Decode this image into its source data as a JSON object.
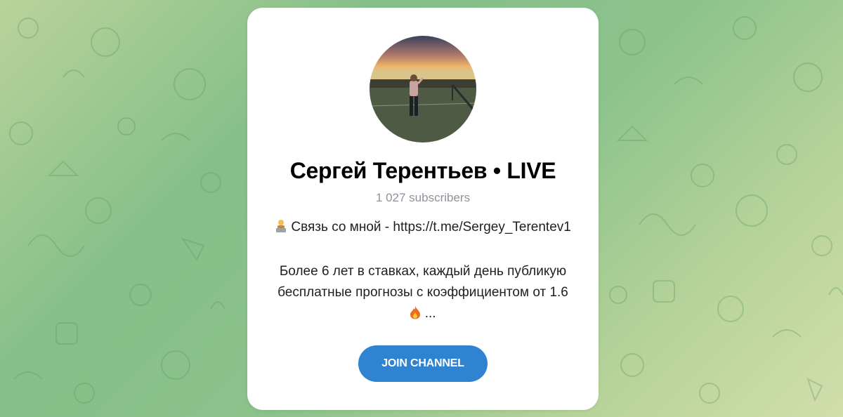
{
  "channel": {
    "title": "Сергей Терентьев • LIVE",
    "subscribers": "1 027 subscribers",
    "description": {
      "contact_icon": "laptop-person-emoji",
      "contact_text": "Связь со мной - https://t.me/Sergey_Terentev1",
      "line1": "Более 6 лет в ставках, каждый день публикую",
      "line2": "бесплатные прогнозы с коэффициентом от 1.6",
      "fire_icon": "fire-emoji",
      "ellipsis": "..."
    },
    "join_label": "JOIN CHANNEL"
  },
  "colors": {
    "accent": "#2f83d0",
    "background_green": "#86bf8a",
    "subtitle_gray": "#8e9399"
  }
}
